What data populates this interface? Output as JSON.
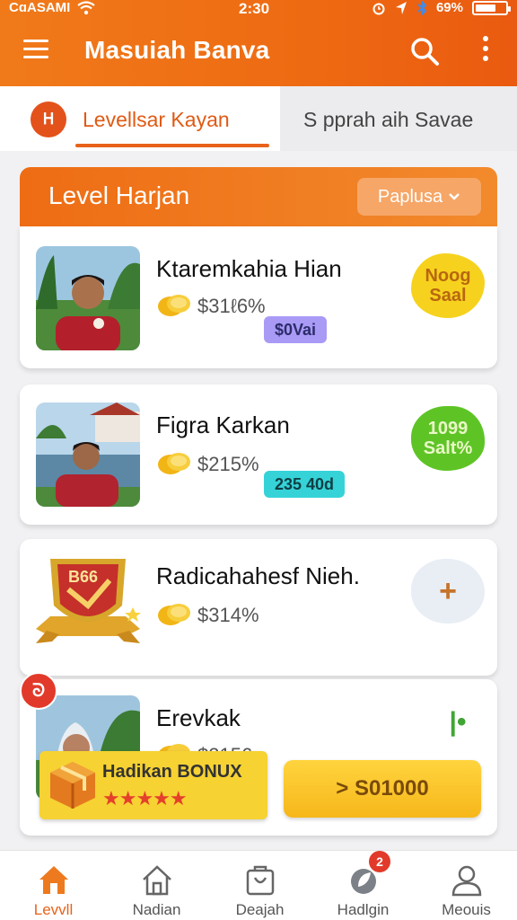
{
  "status_bar": {
    "carrier": "CɑASAMI",
    "time": "2:30",
    "battery": "69%",
    "battery_level": 0.69
  },
  "header": {
    "title": "Masuiah Banva"
  },
  "tabs": [
    {
      "badge": "ᕼ",
      "label": "Levellsar Kayan",
      "active": true
    },
    {
      "label": "S pprah aih  Savae",
      "active": false
    }
  ],
  "section": {
    "title": "Level Harjan",
    "sort_label": "Paplusa"
  },
  "cards": [
    {
      "name": "Ktaremkahia Hian",
      "price": "$31ℓ6%",
      "tag": "$0Vai",
      "tag_color": "#a99af6",
      "blob": "Noog Saal",
      "blob_color": "#f6d21e"
    },
    {
      "name": "Figra Karkan",
      "price": "$215%",
      "tag": "235 40d",
      "tag_color": "#35d3d8",
      "blob": "1099 Salt%",
      "blob_color": "#5ec426"
    },
    {
      "name": "Radicahahesf Nieh.",
      "price": "$314%",
      "badge_text": "B66",
      "blob": "+",
      "blob_color": "#e9eef5"
    },
    {
      "name": "Erevkak",
      "price": "$2156",
      "corner_badge": "ᘐ",
      "blob": "|•"
    }
  ],
  "bonus": {
    "label": "Hadikan BONUX",
    "stars": "★★★★★"
  },
  "cta": {
    "label": "> S01000"
  },
  "bottom_nav": [
    {
      "label": "Levvll",
      "icon": "home-icon",
      "active": true
    },
    {
      "label": "Nadian",
      "icon": "house-outline-icon",
      "active": false
    },
    {
      "label": "Deajah",
      "icon": "bag-icon",
      "active": false
    },
    {
      "label": "Hadlgin",
      "icon": "leaf-icon",
      "badge": "2",
      "active": false
    },
    {
      "label": "Meouis",
      "icon": "user-icon",
      "active": false
    }
  ]
}
